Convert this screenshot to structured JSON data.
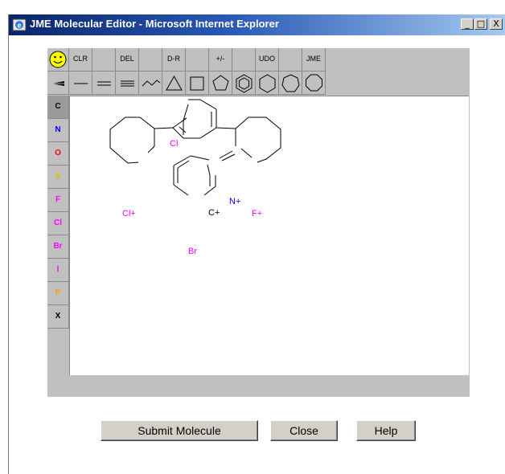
{
  "window": {
    "title": "JME Molecular Editor - Microsoft Internet Explorer",
    "controls": {
      "minimize": "_",
      "maximize": "□",
      "close": "X"
    }
  },
  "toolbar": {
    "row1": [
      {
        "id": "smiley",
        "label": ""
      },
      {
        "id": "clr",
        "label": "CLR"
      },
      {
        "id": "blank1",
        "label": ""
      },
      {
        "id": "del",
        "label": "DEL"
      },
      {
        "id": "blank2",
        "label": ""
      },
      {
        "id": "dr",
        "label": "D-R"
      },
      {
        "id": "blank3",
        "label": ""
      },
      {
        "id": "charge",
        "label": "+/-"
      },
      {
        "id": "blank4",
        "label": ""
      },
      {
        "id": "udo",
        "label": "UDO"
      },
      {
        "id": "blank5",
        "label": ""
      },
      {
        "id": "jme",
        "label": "JME"
      }
    ],
    "row2": [
      "stereo-bond",
      "single-bond",
      "double-bond",
      "triple-bond",
      "chain",
      "ring-3",
      "ring-4",
      "ring-5",
      "ring-benzene",
      "ring-6",
      "ring-7",
      "ring-8"
    ]
  },
  "atoms": [
    {
      "symbol": "C",
      "color": "#000000"
    },
    {
      "symbol": "N",
      "color": "#0000ff"
    },
    {
      "symbol": "O",
      "color": "#ff0000"
    },
    {
      "symbol": "S",
      "color": "#c8c800"
    },
    {
      "symbol": "F",
      "color": "#ff00ff"
    },
    {
      "symbol": "Cl",
      "color": "#ff00ff"
    },
    {
      "symbol": "Br",
      "color": "#ff00ff"
    },
    {
      "symbol": "I",
      "color": "#ff00ff"
    },
    {
      "symbol": "P",
      "color": "#ffa000"
    },
    {
      "symbol": "X",
      "color": "#000000"
    }
  ],
  "molecule": {
    "atom_labels": [
      "Cl",
      "Cl+",
      "N+",
      "F+",
      "C+",
      "Br"
    ]
  },
  "buttons": {
    "submit": "Submit Molecule",
    "close": "Close",
    "help": "Help"
  }
}
